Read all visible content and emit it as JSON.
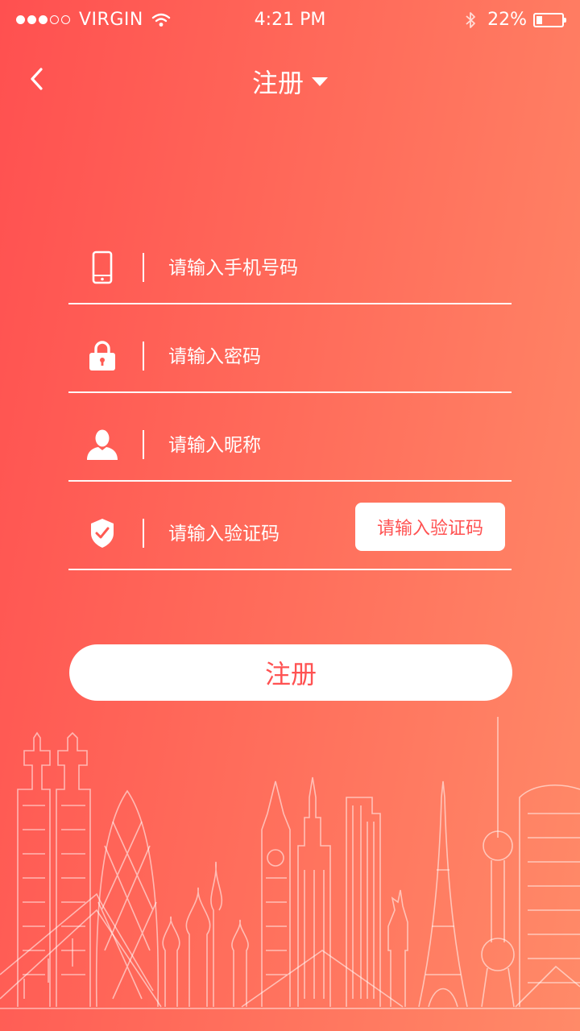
{
  "status_bar": {
    "carrier": "VIRGIN",
    "time": "4:21 PM",
    "battery": "22%",
    "battery_level": 0.22
  },
  "nav": {
    "back_icon": "chevron-left-icon",
    "title": "注册"
  },
  "form": {
    "phone": {
      "icon": "phone-icon",
      "placeholder": "请输入手机号码"
    },
    "password": {
      "icon": "lock-icon",
      "placeholder": "请输入密码"
    },
    "nickname": {
      "icon": "user-icon",
      "placeholder": "请输入昵称"
    },
    "code": {
      "icon": "shield-check-icon",
      "placeholder": "请输入验证码",
      "button_label": "请输入验证码"
    }
  },
  "submit_label": "注册",
  "colors": {
    "gradient_start": "#ff5050",
    "gradient_end": "#ff8a68",
    "accent": "#ff5252",
    "foreground": "#ffffff"
  }
}
